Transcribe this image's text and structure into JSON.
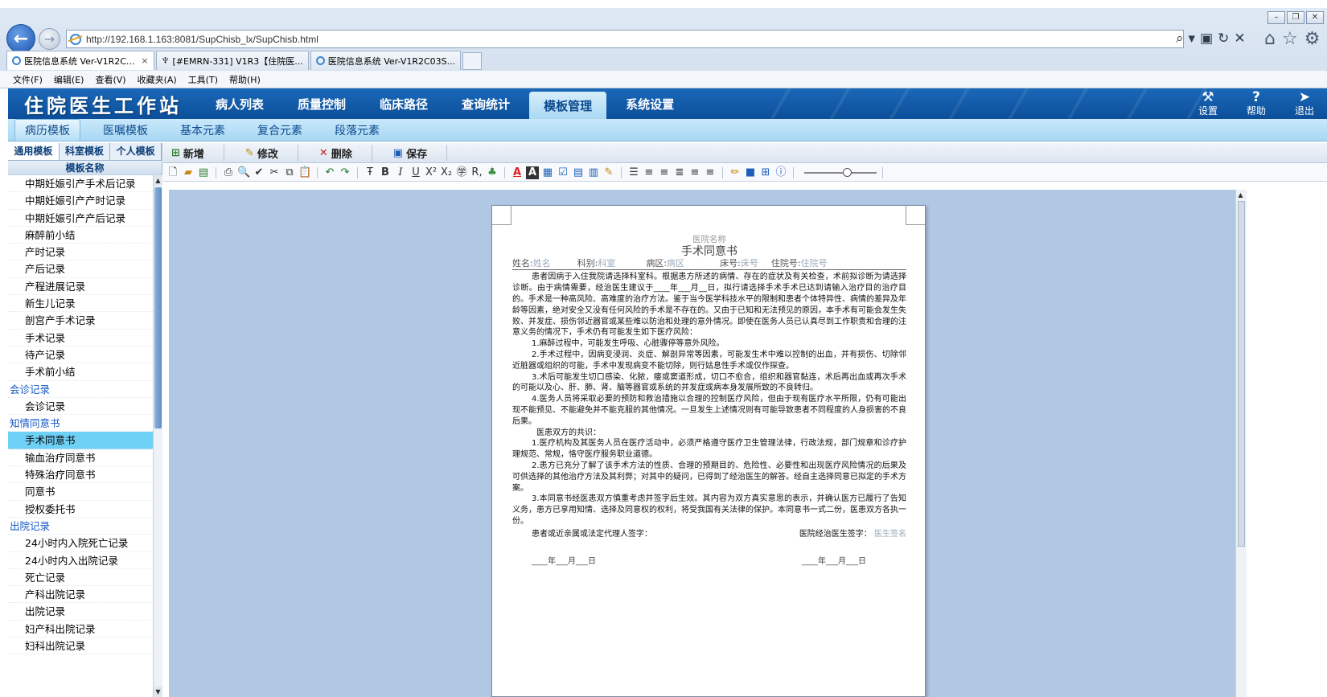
{
  "browser": {
    "url": "http://192.168.1.163:8081/SupChisb_lx/SupChisb.html",
    "tabs": [
      {
        "label": "医院信息系统 Ver-V1R2C...",
        "close": "×"
      },
      {
        "label": "[#EMRN-331] V1R3【住院医..."
      },
      {
        "label": "医院信息系统 Ver-V1R2C03S..."
      }
    ],
    "menu": [
      "文件(F)",
      "编辑(E)",
      "查看(V)",
      "收藏夹(A)",
      "工具(T)",
      "帮助(H)"
    ],
    "window_controls": [
      "–",
      "❐",
      "✕"
    ],
    "tools": [
      "⌕",
      "▾",
      "▣",
      "↻",
      "✕"
    ],
    "right_icons": [
      "⌂",
      "☆",
      "⚙"
    ]
  },
  "app": {
    "title": "住院医生工作站",
    "main_nav": [
      "病人列表",
      "质量控制",
      "临床路径",
      "查询统计",
      "模板管理",
      "系统设置"
    ],
    "main_nav_active": "模板管理",
    "actions": [
      {
        "label": "设置",
        "icon": "wrench-icon",
        "glyph": "⚒"
      },
      {
        "label": "帮助",
        "icon": "help-icon",
        "glyph": "?"
      },
      {
        "label": "退出",
        "icon": "exit-icon",
        "glyph": "➤"
      }
    ],
    "sub_nav": [
      "病历模板",
      "医嘱模板",
      "基本元素",
      "复合元素",
      "段落元素"
    ],
    "sub_nav_active": "病历模板"
  },
  "sidebar": {
    "tabs": [
      "通用模板",
      "科室模板",
      "个人模板"
    ],
    "column_header": "模板名称",
    "items": [
      {
        "label": "中期妊娠引产手术后记录"
      },
      {
        "label": "中期妊娠引产产时记录"
      },
      {
        "label": "中期妊娠引产产后记录"
      },
      {
        "label": "麻醉前小结"
      },
      {
        "label": "产时记录"
      },
      {
        "label": "产后记录"
      },
      {
        "label": "产程进展记录"
      },
      {
        "label": "新生儿记录"
      },
      {
        "label": "剖宫产手术记录"
      },
      {
        "label": "手术记录"
      },
      {
        "label": "待产记录"
      },
      {
        "label": "手术前小结"
      },
      {
        "label": "会诊记录",
        "group": true
      },
      {
        "label": "会诊记录"
      },
      {
        "label": "知情同意书",
        "group": true
      },
      {
        "label": "手术同意书",
        "selected": true
      },
      {
        "label": "输血治疗同意书"
      },
      {
        "label": "特殊治疗同意书"
      },
      {
        "label": "同意书"
      },
      {
        "label": "授权委托书"
      },
      {
        "label": "出院记录",
        "group": true
      },
      {
        "label": "24小时内入院死亡记录"
      },
      {
        "label": "24小时内入出院记录"
      },
      {
        "label": "死亡记录"
      },
      {
        "label": "产科出院记录"
      },
      {
        "label": "出院记录"
      },
      {
        "label": "妇产科出院记录"
      },
      {
        "label": "妇科出院记录"
      }
    ]
  },
  "toolbar": {
    "add": "新增",
    "edit": "修改",
    "delete": "删除",
    "save": "保存"
  },
  "document": {
    "hospital_placeholder": "医院名称",
    "title": "手术同意书",
    "fields": {
      "name_label": "姓名:",
      "name_ph": "姓名",
      "dept_label": "科别:",
      "dept_ph": "科室",
      "ward_label": "病区:",
      "ward_ph": "病区",
      "bed_label": "床号:",
      "bed_ph": "床号",
      "inpatient_label": "住院号:",
      "inpatient_ph": "住院号"
    },
    "p1": "患者因病于入住我院请选择科室科。根据患方所述的病情、存在的症状及有关检查，术前拟诊断为请选择诊断。由于病情需要，经治医生建议于____年___月__日，拟行请选择手术手术已达到请输入治疗目的治疗目的。手术是一种高风险、高难度的治疗方法。鉴于当今医学科技水平的限制和患者个体特异性、病情的差异及年龄等因素，绝对安全又没有任何风险的手术是不存在的。又由于已知和无法预见的原因，本手术有可能会发生失败、并发症、损伤邻近器官或某些难以防治和处理的意外情况。即使在医务人员已认真尽到工作职责和合理的注意义务的情况下，手术仍有可能发生如下医疗风险：",
    "risks": [
      "1.麻醉过程中，可能发生呼吸、心脏骤停等意外风险。",
      "2.手术过程中，因病变浸润、炎症、解剖异常等因素，可能发生术中难以控制的出血，并有损伤、切除邻近脏器或组织的可能，手术中发现病变不能切除，则行姑息性手术或仅作探查。",
      "3.术后可能发生切口感染、化脓，瘘或窦道形成，切口不愈合，组织和器官黏连，术后再出血或再次手术的可能以及心、肝、肺、肾、脑等器官或系统的并发症或病本身发展所致的不良转归。",
      "4.医务人员将采取必要的预防和救治措施以合理的控制医疗风险，但由于现有医疗水平所限，仍有可能出现不能预见、不能避免并不能克服的其他情况。一旦发生上述情况则有可能导致患者不同程度的人身损害的不良后果。"
    ],
    "consensus_title": "医患双方的共识：",
    "consensus": [
      "1.医疗机构及其医务人员在医疗活动中，必须严格遵守医疗卫生管理法律，行政法规，部门规章和诊疗护理规范、常规，恪守医疗服务职业道德。",
      "2.患方已充分了解了该手术方法的性质、合理的预期目的、危险性、必要性和出现医疗风险情况的后果及可供选择的其他治疗方法及其利弊；对其中的疑问，已得到了经治医生的解答。经自主选择同意已拟定的手术方案。",
      "3.本同意书经医患双方慎重考虑并签字后生效。其内容为双方真实意思的表示，并确认医方已履行了告知义务，患方已享用知情、选择及同意权的权利，将受我国有关法律的保护。本同意书一式二份，医患双方各执一份。"
    ],
    "sign_patient": "患者或近亲属或法定代理人签字：",
    "sign_doctor": "医院经治医生签字：",
    "sign_doctor_ph": "医生签名",
    "date_left": "____年___月___日",
    "date_right": "____年___月___日"
  }
}
